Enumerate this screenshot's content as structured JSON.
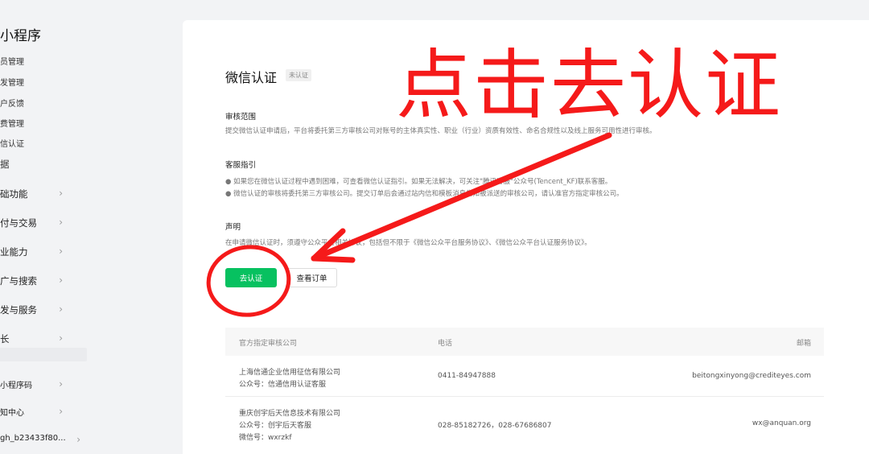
{
  "sidebar": {
    "title": "小程序",
    "sub_items": [
      {
        "label": "员管理"
      },
      {
        "label": "发管理"
      },
      {
        "label": "户反馈"
      },
      {
        "label": "费管理"
      },
      {
        "label": "信认证"
      },
      {
        "label": "据"
      }
    ],
    "groups": [
      {
        "label": "础功能"
      },
      {
        "label": "付与交易"
      },
      {
        "label": "业能力"
      },
      {
        "label": "广与搜索"
      },
      {
        "label": "发与服务"
      },
      {
        "label": "长"
      },
      {
        "label": "小程序码"
      },
      {
        "label": "知中心"
      },
      {
        "label": "gh_b23433f80..."
      }
    ]
  },
  "main": {
    "title": "微信认证",
    "status_badge": "未认证",
    "scope": {
      "heading": "审核范围",
      "text": "提交微信认证申请后，平台将委托第三方审核公司对账号的主体真实性、职业（行业）资质有效性、命名合规性以及线上服务可用性进行审核。"
    },
    "guide": {
      "heading": "客服指引",
      "line1": "● 如果您在微信认证过程中遇到困难，可查看微信认证指引。如果无法解决，可关注\"腾讯客服\"公众号(Tencent_KF)联系客服。",
      "line2": "● 微信认证的审核将委托第三方审核公司。提交订单后会通过站内信和模板消息告知被派送的审核公司，请认准官方指定审核公司。"
    },
    "statement": {
      "heading": "声明",
      "text": "在申请微信认证时，须遵守公众平台相关协议，包括但不限于《微信公众平台服务协议》、《微信公众平台认证服务协议》。"
    },
    "buttons": {
      "primary": "去认证",
      "secondary": "查看订单"
    },
    "table": {
      "headers": [
        "官方指定审核公司",
        "电话",
        "邮箱"
      ],
      "rows": [
        {
          "company": "上海信通企业信用征信有限公司",
          "account": "公众号：信通信用认证客服",
          "wechat": "",
          "phone": "0411-84947888",
          "email": "beitongxinyong@crediteyes.com"
        },
        {
          "company": "重庆创宇后天信息技术有限公司",
          "account": "公众号：创宇后天客服",
          "wechat": "微信号：wxrzkf",
          "phone": "028-85182726，028-67686807",
          "email": "wx@anquan.org"
        }
      ]
    }
  },
  "annotation": {
    "text": "点击去认证",
    "color": "#f51a1a"
  },
  "colors": {
    "primary_green": "#07c160",
    "background": "#f2f3f5"
  }
}
